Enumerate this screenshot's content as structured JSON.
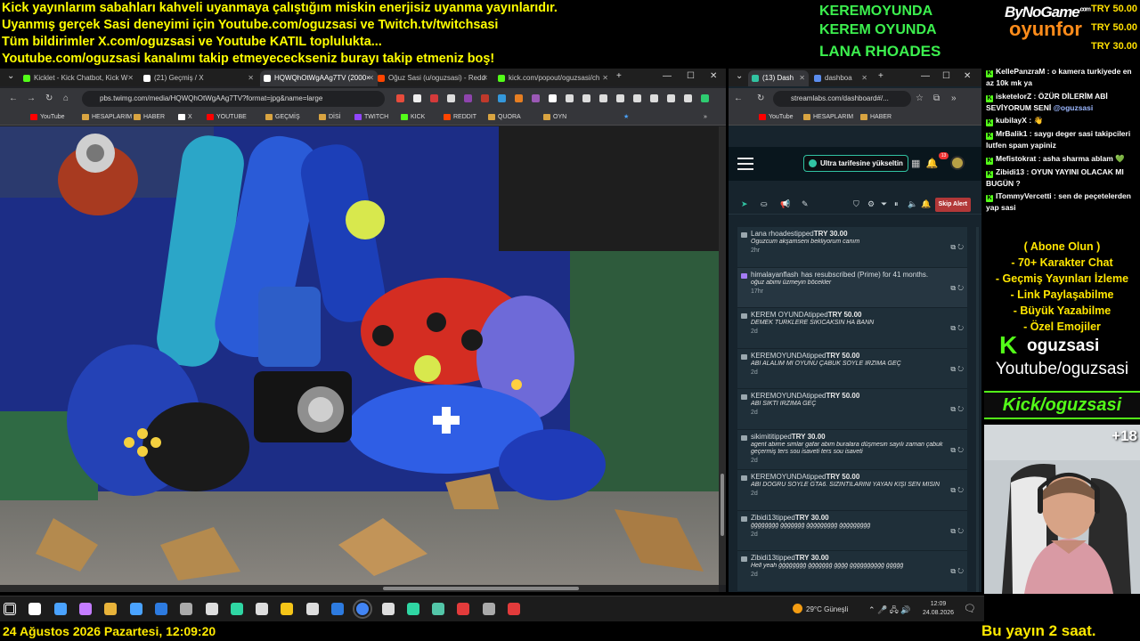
{
  "overlay": {
    "top_lines": [
      "Kick yayınlarım sabahları kahveli uyanmaya çalıştığım miskin enerjisiz uyanma yayınlarıdır.",
      "Uyanmış gerçek Sasi deneyimi için Youtube.com/oguzsasi ve Twitch.tv/twitchsasi",
      "Tüm bildirimler X.com/oguzsasi ve Youtube KATIL toplulukta...",
      "Youtube.com/oguzsasi kanalımı takip etmeyececkseniz burayı takip etmeniz boş!"
    ],
    "recent_names": [
      "KEREMOYUNDA",
      "KEREM OYUNDA",
      "LANA RHOADES"
    ],
    "brand_top": "ByNoGame",
    "brand_com": ".com",
    "brand_bottom": "oyunfor",
    "tip_amounts": [
      "TRY 50.00",
      "TRY 50.00",
      "TRY 30.00"
    ],
    "date_time": "24 Ağustos 2026 Pazartesi, 12:09:20",
    "ticker": "Bu yayın 2 saat."
  },
  "left_browser": {
    "tabs": [
      {
        "label": "Kicklet - Kick Chatbot, Kick W",
        "color": "#53fc18"
      },
      {
        "label": "(21) Geçmiş / X",
        "color": "#ffffff"
      },
      {
        "label": "HQWQhOtWgAAg7TV (2000×",
        "color": "#ffffff"
      },
      {
        "label": "Oğuz Sasi (u/oguzsasi) - Redd",
        "color": "#ff4500"
      },
      {
        "label": "kick.com/popout/oguzsasi/ch",
        "color": "#53fc18"
      }
    ],
    "url": "pbs.twimg.com/media/HQWQhOtWgAAg7TV?format=jpg&name=large",
    "bookmarks": [
      "YouTube",
      "HESAPLARIM",
      "HABER",
      "X",
      "YOUTUBE",
      "GEÇMİŞ",
      "DİSİ",
      "TWITCH",
      "KICK",
      "REDDIT",
      "QUORA",
      "OYN"
    ],
    "bookmark_colors": [
      "#ff0000",
      "#d9a441",
      "#d9a441",
      "#ffffff",
      "#ff0000",
      "#d9a441",
      "#d9a441",
      "#9146ff",
      "#53fc18",
      "#ff4500",
      "#d9a441",
      "#d9a441"
    ]
  },
  "right_browser": {
    "tabs": [
      {
        "label": "(13) Dash",
        "color": "#31c3a2"
      },
      {
        "label": "dashboa",
        "color": "#5b8dee"
      }
    ],
    "url": "streamlabs.com/dashboard#/...",
    "bookmarks": [
      "YouTube",
      "HESAPLARIM",
      "HABER"
    ],
    "upgrade_label": "Ultra tarifesine yükseltin",
    "notification_count": "13",
    "skip_alert_label": "Skip Alert",
    "events": [
      {
        "type": "tip",
        "name": "Lana rhoades",
        "action": "tipped",
        "amount": "TRY 30.00",
        "message": "Oguzcum akşamseni bekliyorum canım",
        "ago": "2hr"
      },
      {
        "type": "sub",
        "name": "himalayanflash",
        "action": "has resubscribed (Prime) for 41 months.",
        "amount": "",
        "message": "oğuz abimi üzmeyin böcekler",
        "ago": "17hr"
      },
      {
        "type": "tip",
        "name": "KEREM OYUNDA",
        "action": "tipped",
        "amount": "TRY 50.00",
        "message": "DEMEK TÜRKLERE SIKICAKSIN HA BANN",
        "ago": "2d"
      },
      {
        "type": "tip",
        "name": "KEREMOYUNDA",
        "action": "tipped",
        "amount": "TRY 50.00",
        "message": "ABİ ALALIM MI OYUNU ÇABUK SÖYLE IRZIMA GEÇ",
        "ago": "2d"
      },
      {
        "type": "tip",
        "name": "KEREMOYUNDA",
        "action": "tipped",
        "amount": "TRY 50.00",
        "message": "ABİ SIKTI IRZIMA GEÇ",
        "ago": "2d"
      },
      {
        "type": "tip",
        "name": "sikimiti",
        "action": "tipped",
        "amount": "TRY 30.00",
        "message": "agent abime simlar gafar abim buralara düşmesin sayılı zaman çabuk geçermiş ters sou isaveti ters sou isaveti",
        "ago": "2d"
      },
      {
        "type": "tip",
        "name": "KEREMOYUNDA",
        "action": "tipped",
        "amount": "TRY 50.00",
        "message": "ABİ DOĞRU SÖYLE GTA6. SIZINTILARINI YAYAN KİŞİ SEN MİSİN",
        "ago": "2d"
      },
      {
        "type": "tip",
        "name": "Zibidi13",
        "action": "tipped",
        "amount": "TRY 30.00",
        "message": "ğğğğğğğğ ğğğğğğğ ğğğğğğğğğ ğğğğğğğğğ",
        "ago": "2d"
      },
      {
        "type": "tip",
        "name": "Zibidi13",
        "action": "tipped",
        "amount": "TRY 30.00",
        "message": "Hell yeah ğğğğğğğğ ğğğğğğğ ğğğğ ğğğğğğğğğğ ğğğğğ",
        "ago": "2d"
      }
    ]
  },
  "chat": [
    {
      "user": "KellePanzraM",
      "text": "o kamera turkiyede en az 10k mk ya",
      "mention": ""
    },
    {
      "user": "isketelorZ",
      "text": "ÖZÜR DİLERİM ABİ SEVİYORUM SENİ",
      "mention": "@oguzsasi"
    },
    {
      "user": "kubilayX",
      "text": "👋",
      "mention": ""
    },
    {
      "user": "MrBalik1",
      "text": "saygı deger sasi takipcileri lutfen spam yapiniz",
      "mention": ""
    },
    {
      "user": "Mefistokrat",
      "text": "asha sharma ablam 💚",
      "mention": ""
    },
    {
      "user": "Zibidi13",
      "text": "OYUN YAYINI OLACAK MI BUGÜN ?",
      "mention": ""
    },
    {
      "user": "ITommyVercetti",
      "text": "sen de peçetelerden yap sasi",
      "mention": ""
    }
  ],
  "promo": [
    "( Abone Olun )",
    "- 70+ Karakter Chat",
    "- Geçmiş Yayınları İzleme",
    "- Link Paylaşabilme",
    "- Büyük Yazabilme",
    "- Özel Emojiler"
  ],
  "channel_name": "oguzsasi",
  "youtube_handle": "Youtube/oguzsasi",
  "kick_handle": "Kick/oguzsasi",
  "viewer_count": "+18",
  "taskbar": {
    "weather": "29°C  Güneşli",
    "time": "12:09",
    "date": "24.08.2026",
    "icons": [
      "#ffffff",
      "#ffffff",
      "#4aa3ff",
      "#c47cff",
      "#e8b33a",
      "#4aa3ff",
      "#2d7be0",
      "#aaaaaa",
      "#dddddd",
      "#2fd6a3",
      "#dddddd",
      "#f5c518",
      "#dddddd",
      "#2d7be0",
      "#4285f4",
      "#dddddd",
      "#2fd6a3",
      "#53c6a8",
      "#e33b3b",
      "#aaaaaa",
      "#e33b3b"
    ]
  }
}
